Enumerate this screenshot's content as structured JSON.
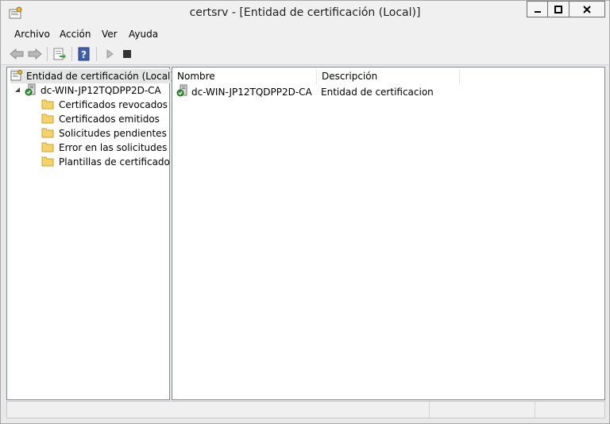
{
  "window": {
    "title": "certsrv - [Entidad de certificación (Local)]"
  },
  "menu": {
    "items": [
      "Archivo",
      "Acción",
      "Ver",
      "Ayuda"
    ]
  },
  "toolbar": {
    "icons": [
      "back-arrow-icon",
      "forward-arrow-icon",
      "export-list-icon",
      "help-icon",
      "play-icon",
      "stop-icon"
    ]
  },
  "tree": {
    "root_label": "Entidad de certificación (Local)",
    "ca_label": "dc-WIN-JP12TQDPP2D-CA",
    "folders": [
      "Certificados revocados",
      "Certificados emitidos",
      "Solicitudes pendientes",
      "Error en las solicitudes",
      "Plantillas de certificado"
    ]
  },
  "list": {
    "columns": [
      "Nombre",
      "Descripción"
    ],
    "rows": [
      {
        "name": "dc-WIN-JP12TQDPP2D-CA",
        "description": "Entidad de certificacion"
      }
    ]
  },
  "colors": {
    "folder": "#f5d26a",
    "selection": "#e5e5e5",
    "cert_green": "#2e9b2e"
  }
}
